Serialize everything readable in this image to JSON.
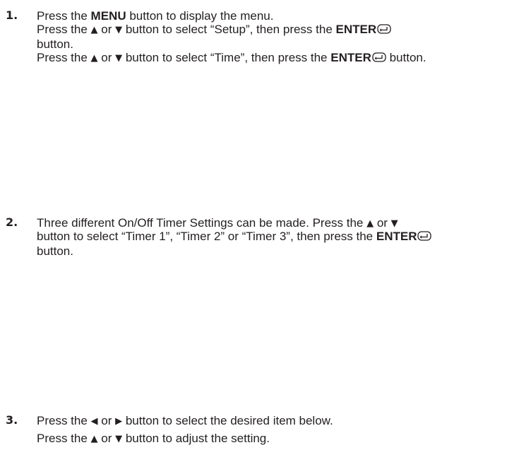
{
  "steps": [
    {
      "number": "1.",
      "lines": [
        {
          "pre": "Press the ",
          "key": "MENU",
          "post": " button to display the menu."
        },
        {
          "pre": "Press the ",
          "up": "▲",
          "or": " or ",
          "down": "▼",
          "mid": " button to select “Setup”, then press the ",
          "key": "ENTER",
          "post": ""
        },
        {
          "text": "button."
        },
        {
          "pre": "Press the ",
          "up": "▲",
          "or": " or ",
          "down": "▼",
          "mid": " button to select “Time”, then press the ",
          "key": "ENTER",
          "post": " button."
        }
      ]
    },
    {
      "number": "2.",
      "lines": [
        {
          "pre": "Three different On/Off Timer Settings can be made. Press the ",
          "up": "▲",
          "or": " or ",
          "down": "▼"
        },
        {
          "pre": "button to select “Timer 1”, “Timer 2” or “Timer 3”, then press the ",
          "key": "ENTER",
          "post": ""
        },
        {
          "text": "button."
        }
      ]
    },
    {
      "number": "3.",
      "lines": [
        {
          "pre": "Press the ",
          "left": "◀",
          "or": " or ",
          "right": "▶",
          "post": " button to select the desired item below."
        },
        {
          "pre": "Press the ",
          "up": "▲",
          "or": " or ",
          "down": "▼",
          "post": " button to adjust the setting."
        }
      ]
    }
  ],
  "icons": {
    "enter": "enter-return-icon",
    "up": "up-triangle-icon",
    "down": "down-triangle-icon",
    "left": "left-triangle-icon",
    "right": "right-triangle-icon"
  }
}
